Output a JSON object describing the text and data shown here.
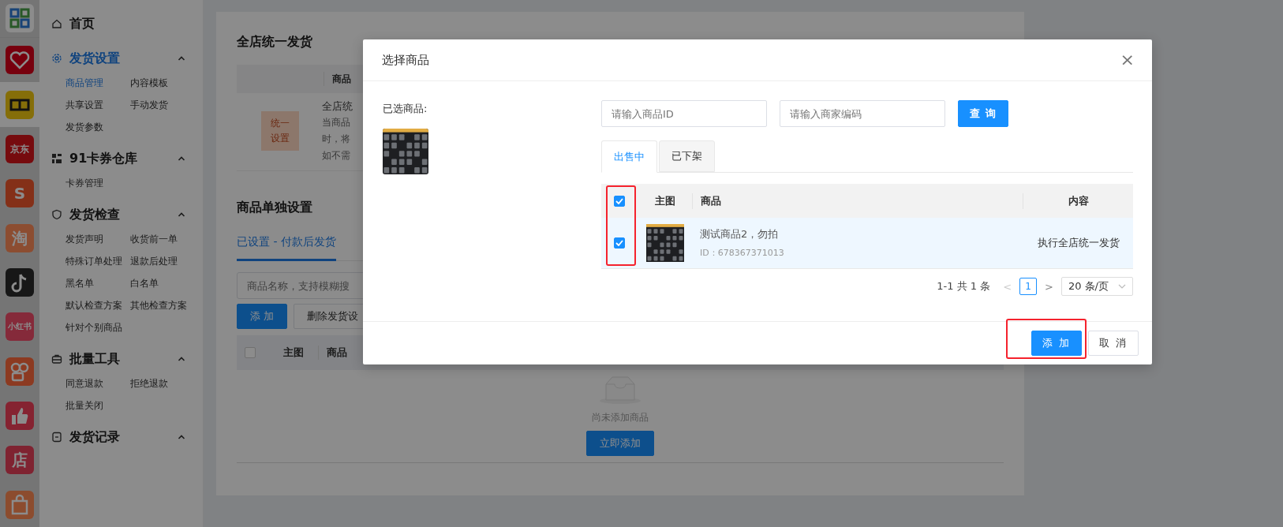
{
  "app_bar": [
    {
      "selected": false
    },
    {
      "selected": false
    },
    {
      "selected": true
    },
    {
      "label": "京东",
      "selected": false
    },
    {
      "label": "S",
      "selected": false
    },
    {
      "label": "淘",
      "selected": false
    },
    {
      "selected": false
    },
    {
      "label": "小红书",
      "selected": false
    },
    {
      "selected": false
    },
    {
      "selected": false
    },
    {
      "label": "店",
      "selected": false
    },
    {
      "selected": false
    }
  ],
  "sidebar": {
    "items": [
      {
        "label": "首页",
        "selected": false
      },
      {
        "label": "发货设置",
        "selected": true,
        "expanded": true,
        "children": [
          {
            "label": "商品管理",
            "selected": true
          },
          {
            "label": "内容模板",
            "selected": false
          },
          {
            "label": "共享设置",
            "selected": false
          },
          {
            "label": "手动发货",
            "selected": false
          },
          {
            "label": "发货参数",
            "selected": false
          }
        ]
      },
      {
        "label": "91卡券仓库",
        "selected": false,
        "expanded": true,
        "children": [
          {
            "label": "卡券管理",
            "selected": false
          }
        ]
      },
      {
        "label": "发货检查",
        "selected": false,
        "expanded": true,
        "children": [
          {
            "label": "发货声明",
            "selected": false
          },
          {
            "label": "收货前一单",
            "selected": false
          },
          {
            "label": "特殊订单处理",
            "selected": false
          },
          {
            "label": "退款后处理",
            "selected": false
          },
          {
            "label": "黑名单",
            "selected": false
          },
          {
            "label": "白名单",
            "selected": false
          },
          {
            "label": "默认检查方案",
            "selected": false
          },
          {
            "label": "其他检查方案",
            "selected": false
          },
          {
            "label": "针对个别商品",
            "selected": false
          }
        ]
      },
      {
        "label": "批量工具",
        "selected": false,
        "expanded": true,
        "children": [
          {
            "label": "同意退款",
            "selected": false
          },
          {
            "label": "拒绝退款",
            "selected": false
          },
          {
            "label": "批量关闭",
            "selected": false
          }
        ]
      },
      {
        "label": "发货记录",
        "selected": false,
        "expanded": true
      }
    ]
  },
  "page": {
    "global_section": {
      "title": "全店统一发货",
      "column_header": "商品",
      "badge": "统一设置",
      "lines": [
        "全店统",
        "当商品",
        "时，将",
        "如不需"
      ]
    },
    "single_section": {
      "title": "商品单独设置",
      "tabs": [
        {
          "label": "已设置 - 付款后发货",
          "selected": true
        }
      ],
      "search": {
        "placeholder": "商品名称，支持模糊搜"
      },
      "buttons": [
        {
          "label": "添 加",
          "kind": "primary"
        },
        {
          "label": "删除发货设",
          "kind": "default"
        }
      ],
      "table": {
        "columns": [
          "主图",
          "商品"
        ],
        "checked": false
      },
      "empty": {
        "text": "尚未添加商品",
        "button": "立即添加"
      }
    }
  },
  "modal": {
    "title": "选择商品",
    "close": "×",
    "selected_label": "已选商品:",
    "search": [
      {
        "placeholder": "请输入商品ID"
      },
      {
        "placeholder": "请输入商家编码"
      }
    ],
    "query_button": "查 询",
    "tabs": [
      {
        "label": "出售中",
        "selected": true
      },
      {
        "label": "已下架",
        "selected": false
      }
    ],
    "table": {
      "columns": [
        "主图",
        "商品",
        "内容"
      ],
      "all_checked": true,
      "select_column_highlighted": true,
      "rows": [
        {
          "checked": true,
          "name": "测试商品2，勿拍",
          "id": "ID：678367371013",
          "content": "执行全店统一发货"
        }
      ]
    },
    "pagination": {
      "summary": "1-1 共 1 条",
      "prev": "<",
      "pages": [
        {
          "label": "1",
          "selected": true
        }
      ],
      "next": ">",
      "page_size": "20 条/页"
    },
    "buttons": [
      {
        "label": "添 加",
        "kind": "primary",
        "highlighted": true
      },
      {
        "label": "取 消",
        "kind": "default"
      }
    ]
  }
}
